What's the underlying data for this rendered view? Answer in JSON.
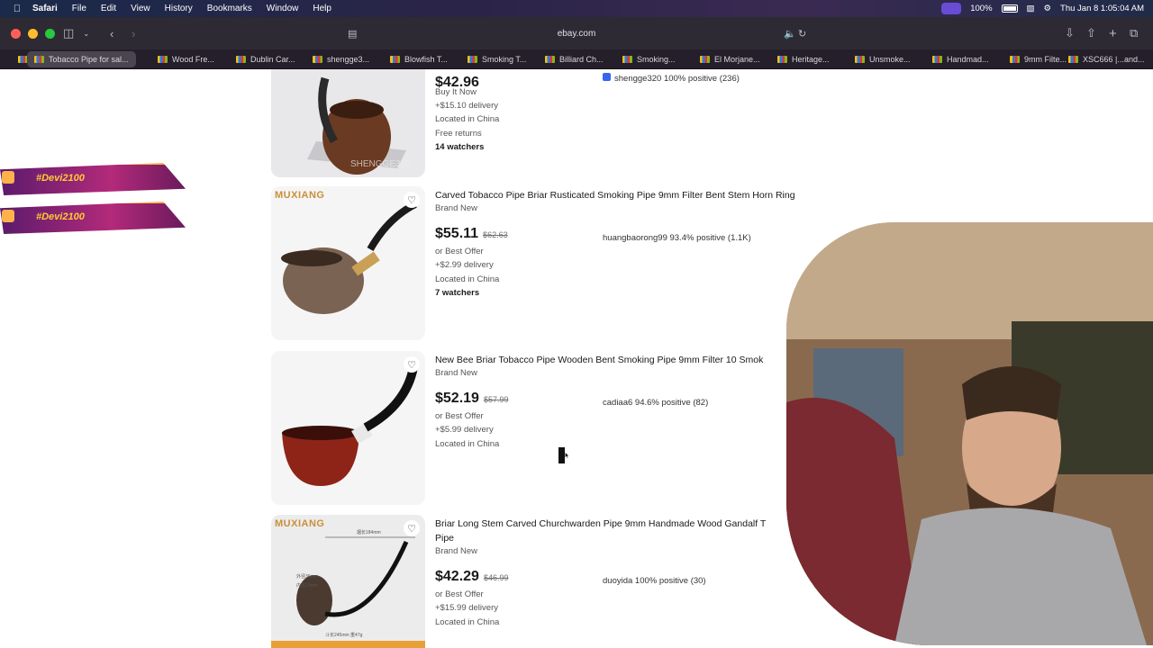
{
  "menubar": {
    "app": "Safari",
    "items": [
      "File",
      "Edit",
      "View",
      "History",
      "Bookmarks",
      "Window",
      "Help"
    ],
    "battery": "100%",
    "datetime": "Thu Jan 8  1:05:04 AM"
  },
  "toolbar": {
    "url": "ebay.com"
  },
  "tabs": [
    {
      "label": "Tobacco Pipe for sal...",
      "active": true
    },
    {
      "label": "Wood Fre..."
    },
    {
      "label": "Dublin Car..."
    },
    {
      "label": "shengge3..."
    },
    {
      "label": "Blowfish T..."
    },
    {
      "label": "Smoking T..."
    },
    {
      "label": "Billiard Ch..."
    },
    {
      "label": "Smoking..."
    },
    {
      "label": "El Morjane..."
    },
    {
      "label": "Heritage..."
    },
    {
      "label": "Unsmoke..."
    },
    {
      "label": "Handmad..."
    },
    {
      "label": "9mm Filte..."
    },
    {
      "label": "XSC666 |..."
    },
    {
      "label": "and..."
    }
  ],
  "overlay": {
    "handle1": "#Devi2100",
    "handle2": "#Devi2100"
  },
  "listings": [
    {
      "price_partial": "$42.96",
      "buy_format": "Buy It Now",
      "delivery": "+$15.10 delivery",
      "location": "Located in China",
      "returns": "Free returns",
      "watchers": "14 watchers",
      "seller": "shengge320 100% positive (236)",
      "watermark": "SHENGGE320"
    },
    {
      "title": "Carved Tobacco Pipe Briar Rusticated Smoking Pipe 9mm Filter Bent Stem Horn Ring",
      "condition": "Brand New",
      "price": "$55.11",
      "was": "$62.63",
      "offer": "or Best Offer",
      "delivery": "+$2.99 delivery",
      "location": "Located in China",
      "watchers": "7 watchers",
      "seller": "huangbaorong99 93.4% positive (1.1K)",
      "brand": "MUXIANG"
    },
    {
      "title": "New Bee Briar Tobacco Pipe Wooden Bent Smoking Pipe 9mm Filter 10 Smok",
      "condition": "Brand New",
      "price": "$52.19",
      "was": "$57.99",
      "offer": "or Best Offer",
      "delivery": "+$5.99 delivery",
      "location": "Located in China",
      "seller": "cadiaa6 94.6% positive (82)"
    },
    {
      "title": "Briar Long Stem Carved Churchwarden Pipe 9mm Handmade Wood Gandalf T",
      "title2": "Pipe",
      "condition": "Brand New",
      "price": "$42.29",
      "was": "$46.99",
      "offer": "or Best Offer",
      "delivery": "+$15.99 delivery",
      "location": "Located in China",
      "seller": "duoyida 100% positive (30)",
      "brand": "MUXIANG",
      "dim_length": "烟长184mm",
      "dim_outer": "外径36mm",
      "dim_inner": "内径20mm",
      "dim_weight": "斗长245mm  重47g"
    }
  ],
  "colors": {
    "ebay_text": "#191919",
    "muted": "#555555",
    "tab_active": "#4a4550",
    "menubar_accent": "#6a4bd6"
  }
}
